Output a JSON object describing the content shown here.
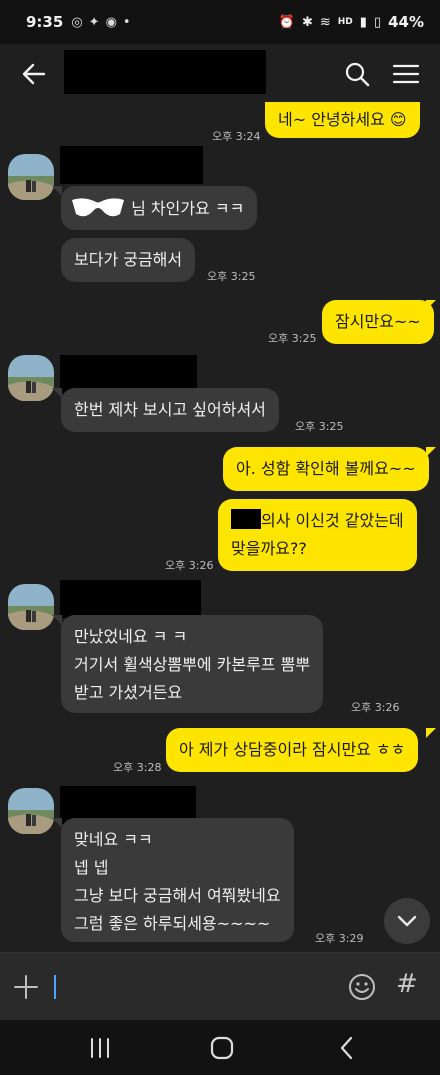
{
  "status": {
    "time": "9:35",
    "battery": "44%",
    "network": "HD"
  },
  "header": {
    "back_icon": "arrow-left-icon",
    "search_icon": "search-icon",
    "menu_icon": "hamburger-menu-icon"
  },
  "messages": [
    {
      "side": "out",
      "text": "네~ 안녕하세요 😊",
      "time": "오후 3:24"
    },
    {
      "side": "in",
      "text": "님 차인가요 ㅋㅋ"
    },
    {
      "side": "in",
      "text": "보다가 궁금해서",
      "time": "오후 3:25"
    },
    {
      "side": "out",
      "text": "잠시만요~~",
      "time": "오후 3:25"
    },
    {
      "side": "in",
      "text": "한번 제차 보시고 싶어하셔서",
      "time": "3:25"
    },
    {
      "side": "out",
      "text": "아. 성함 확인해 볼께요~~"
    },
    {
      "side": "out",
      "line1": "의사 이신것 같았는데",
      "line2": "맞을까요??",
      "time": "오후 3:26"
    },
    {
      "side": "in",
      "lines": [
        "만났었네요 ㅋ ㅋ",
        "거기서 휠색상뽐뿌에 카본루프 뽐뿌",
        "받고 가셨거든요"
      ],
      "time": "오후 3:26"
    },
    {
      "side": "out",
      "text": "아 제가 상담중이라 잠시만요 ㅎㅎ",
      "time": "오후 3:28"
    },
    {
      "side": "in",
      "lines": [
        "맞네요 ㅋㅋ",
        "넵 넵",
        "그냥 보다 궁금해서 여쭤봤네요",
        "그럼 좋은 하루되세용~~~~"
      ],
      "time": "오후 3:29"
    }
  ],
  "input": {
    "plus_icon": "plus-icon",
    "emoji_icon": "emoji-icon",
    "hash_label": "#"
  },
  "colors": {
    "out_bubble": "#fee500",
    "in_bubble": "#3a3a3a",
    "background": "#1f1f1f"
  }
}
